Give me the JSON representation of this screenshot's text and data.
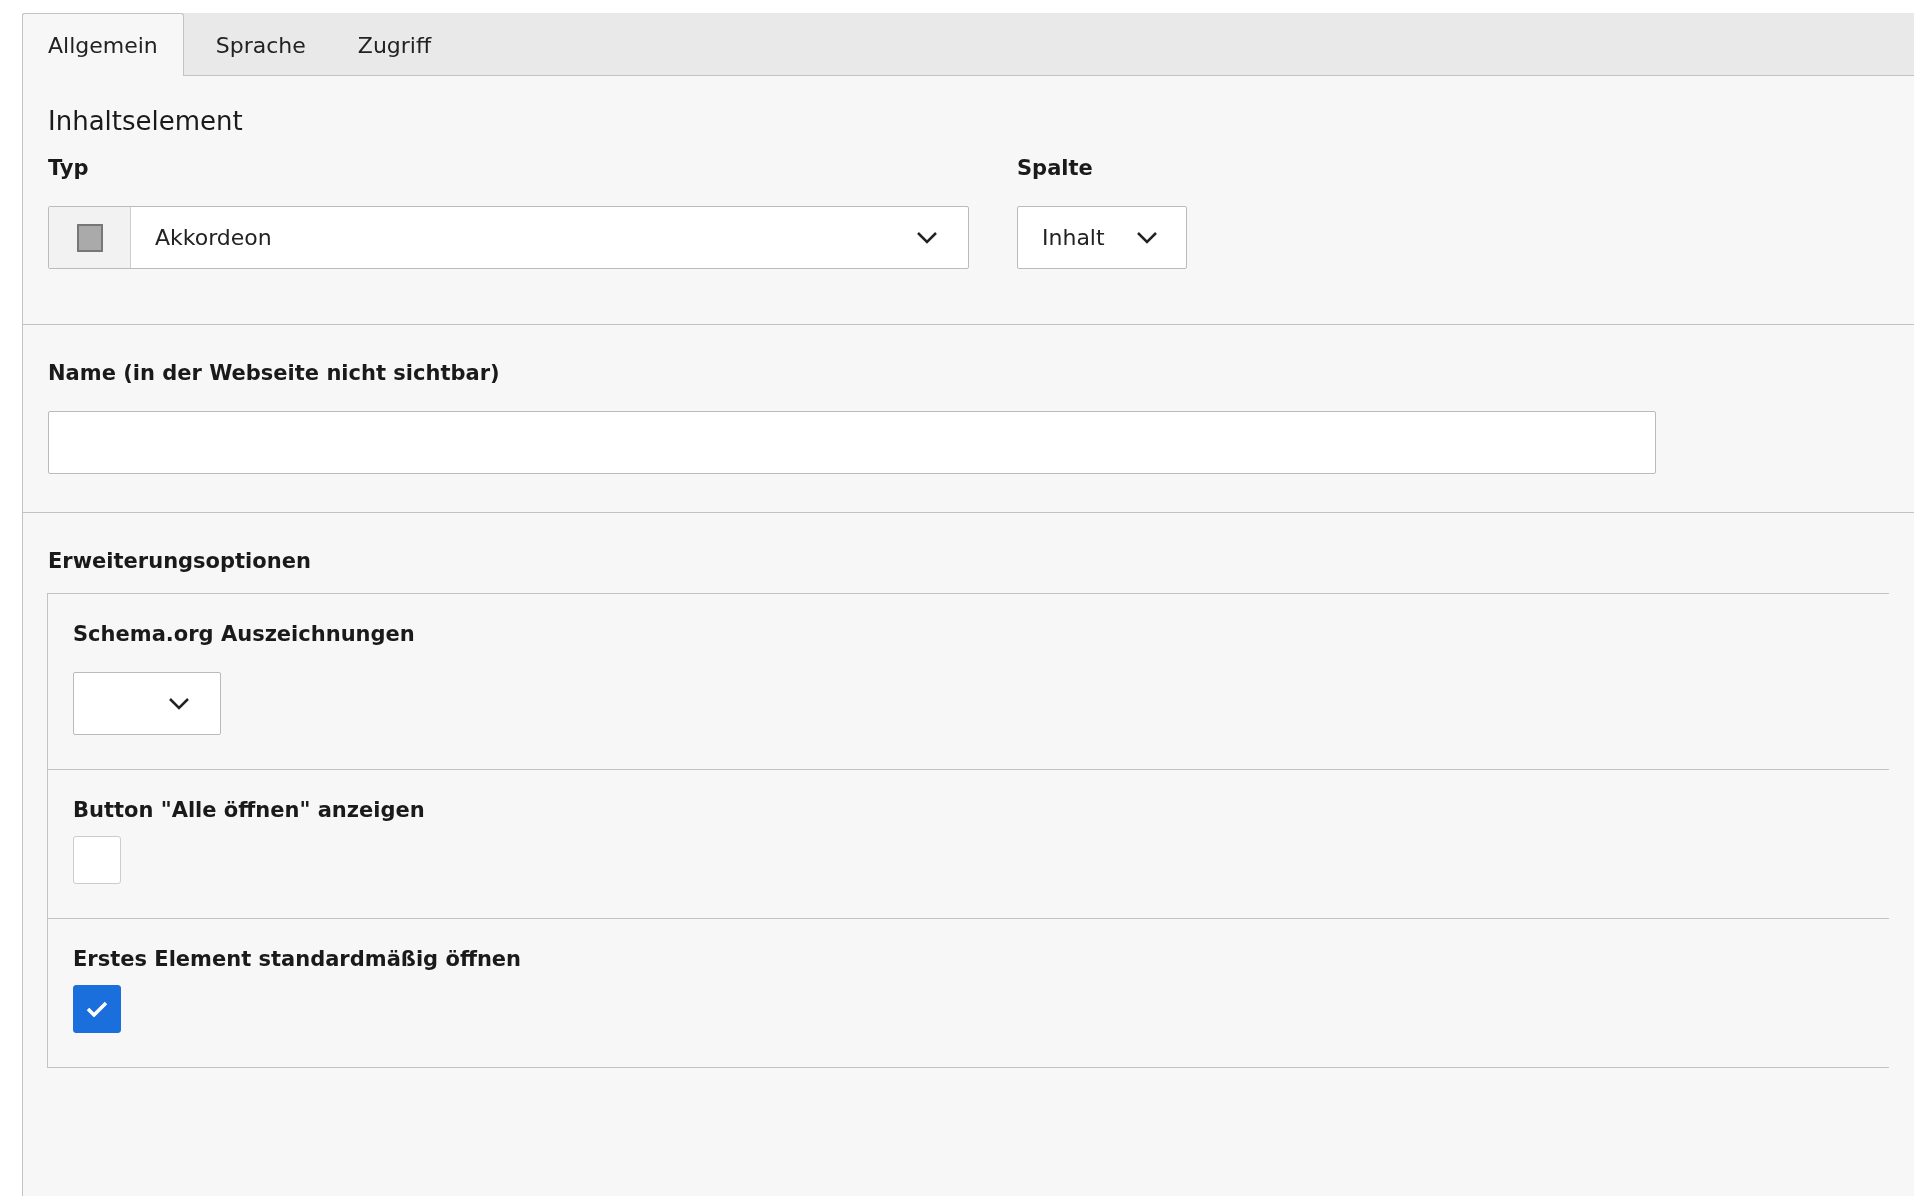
{
  "tabs": [
    {
      "label": "Allgemein",
      "selected": true
    },
    {
      "label": "Sprache",
      "selected": false
    },
    {
      "label": "Zugriff",
      "selected": false
    }
  ],
  "section_title": "Inhaltselement",
  "type_field": {
    "label": "Typ",
    "value": "Akkordeon"
  },
  "column_field": {
    "label": "Spalte",
    "value": "Inhalt"
  },
  "name_field": {
    "label": "Name (in der Webseite nicht sichtbar)"
  },
  "extension": {
    "title": "Erweiterungsoptionen",
    "items": [
      {
        "kind": "select",
        "label": "Schema.org Auszeichnungen"
      },
      {
        "kind": "checkbox",
        "label": "Button \"Alle öffnen\" anzeigen",
        "checked": false
      },
      {
        "kind": "checkbox",
        "label": "Erstes Element standardmäßig öffnen",
        "checked": true
      }
    ]
  }
}
